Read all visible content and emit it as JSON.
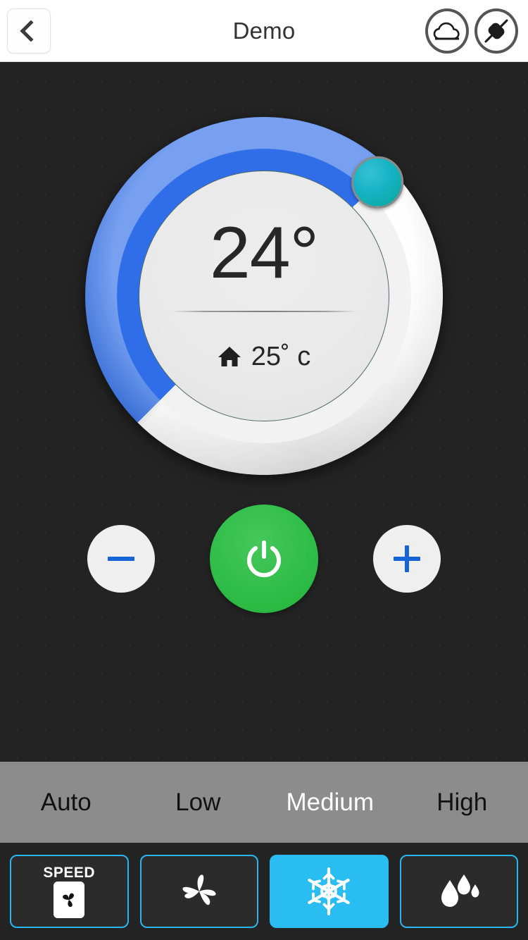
{
  "header": {
    "back_label": "chevron-left",
    "title": "Demo",
    "actions": [
      {
        "name": "cloud",
        "label": "cloud-icon"
      },
      {
        "name": "plug",
        "label": "plug-icon"
      }
    ]
  },
  "dial": {
    "set_temperature": "24°",
    "ambient_temperature": "25˚ c",
    "ambient_icon": "home-icon",
    "arc_color": "#2f6ee8",
    "thumb_color": "#12b1b4",
    "track_color": "#f2f2f2"
  },
  "controls": {
    "decrease_label": "−",
    "power_label": "power-icon",
    "increase_label": "+",
    "power_color": "#2fbe4a",
    "sign_color": "#1565d8"
  },
  "fan_speed": {
    "selected": "Medium",
    "options": [
      {
        "label": "Auto",
        "selected": false
      },
      {
        "label": "Low",
        "selected": false
      },
      {
        "label": "Medium",
        "selected": true
      },
      {
        "label": "High",
        "selected": false
      }
    ]
  },
  "modes": {
    "accent_color": "#29bdf2",
    "items": [
      {
        "name": "speed",
        "icon": "fan-speed-icon",
        "text": "SPEED",
        "selected": false
      },
      {
        "name": "fan",
        "icon": "fan-blades-icon",
        "text": "",
        "selected": false
      },
      {
        "name": "cool",
        "icon": "snowflake-icon",
        "text": "",
        "selected": true
      },
      {
        "name": "dry",
        "icon": "water-drops-icon",
        "text": "",
        "selected": false
      }
    ]
  }
}
